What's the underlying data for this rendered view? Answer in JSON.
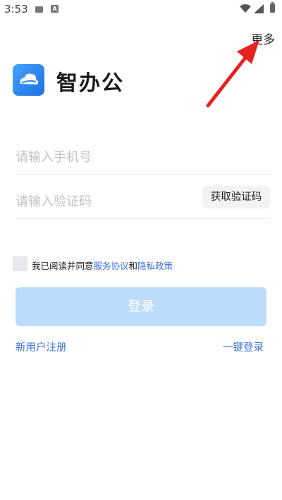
{
  "status_bar": {
    "time": "3:53",
    "a_badge": "A",
    "icons": [
      "image-icon",
      "a-icon",
      "wifi-icon",
      "signal-icon",
      "battery-icon"
    ]
  },
  "header": {
    "more": "更多"
  },
  "app": {
    "name": "智办公",
    "logo_icon": "cloud-logo-icon",
    "brand_color": "#2f86f0"
  },
  "form": {
    "phone_placeholder": "请输入手机号",
    "code_placeholder": "请输入验证码",
    "get_code": "获取验证码"
  },
  "agreement": {
    "prefix": "我已阅读并同意",
    "service": "服务协议",
    "and": "和",
    "privacy": "隐私政策",
    "checked": false
  },
  "login_button": "登录",
  "links": {
    "register": "新用户注册",
    "one_key": "一键登录"
  },
  "colors": {
    "link": "#3b73d9",
    "button_disabled": "#bcdcfb",
    "annotation_arrow": "#e82020"
  }
}
